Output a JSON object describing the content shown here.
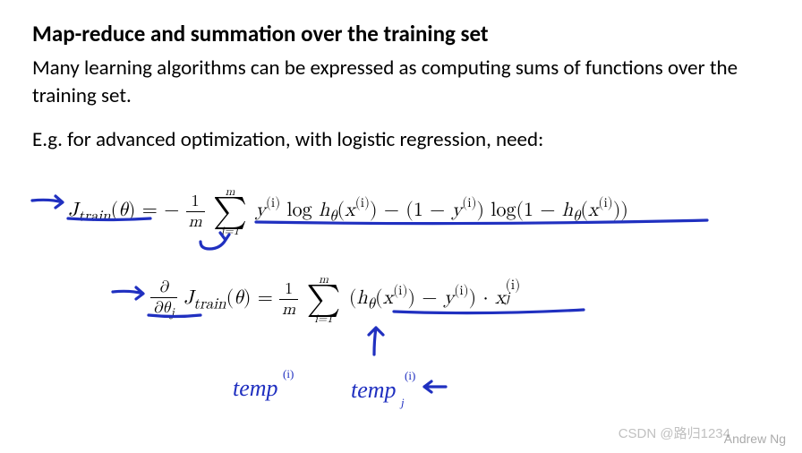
{
  "title": "Map-reduce and summation over the training set",
  "paragraph1": "Many learning algorithms can be expressed as computing sums of functions over the training set.",
  "paragraph2": "E.g. for advanced optimization, with logistic regression, need:",
  "eq1": {
    "lhs": "J_train(θ)",
    "lhs_html": {
      "J": "J",
      "sub": "train",
      "arg": "θ"
    },
    "equals": " = ",
    "minus": "−",
    "frac_num": "1",
    "frac_den": "m",
    "sum_top": "m",
    "sum_bot": "i=1",
    "term_a": "y",
    "term_a_sup": "(i)",
    "log1": " log ",
    "h": "h",
    "h_sub": "θ",
    "x": "x",
    "x_sup": "(i)",
    "sep": " − (1 − ",
    "close1": ") ",
    "log2": "log(1 − ",
    "close2": "))"
  },
  "eq2": {
    "partial_num_html": "∂",
    "partial_den_html": "∂θ",
    "partial_den_sub": "j",
    "J": "J",
    "Jsub": "train",
    "Jarg": "θ",
    "equals": " = ",
    "frac_num": "1",
    "frac_den": "m",
    "sum_top": "m",
    "sum_bot": "i=1",
    "open": "(",
    "h": "h",
    "h_sub": "θ",
    "x": "x",
    "x_sup": "(i)",
    "minus_y": ") − ",
    "y": "y",
    "y_sup": "(i)",
    "close_dot": ") · ",
    "xj": "x",
    "xj_sub": "j",
    "xj_sup": "(i)"
  },
  "annotations": {
    "temp1": "temp",
    "temp1_sup": "(i)",
    "temp2": "temp",
    "temp2_sub": "j",
    "temp2_sup": "(i)"
  },
  "watermarks": {
    "csdn": "CSDN @路归1234",
    "andrew": "Andrew Ng"
  }
}
